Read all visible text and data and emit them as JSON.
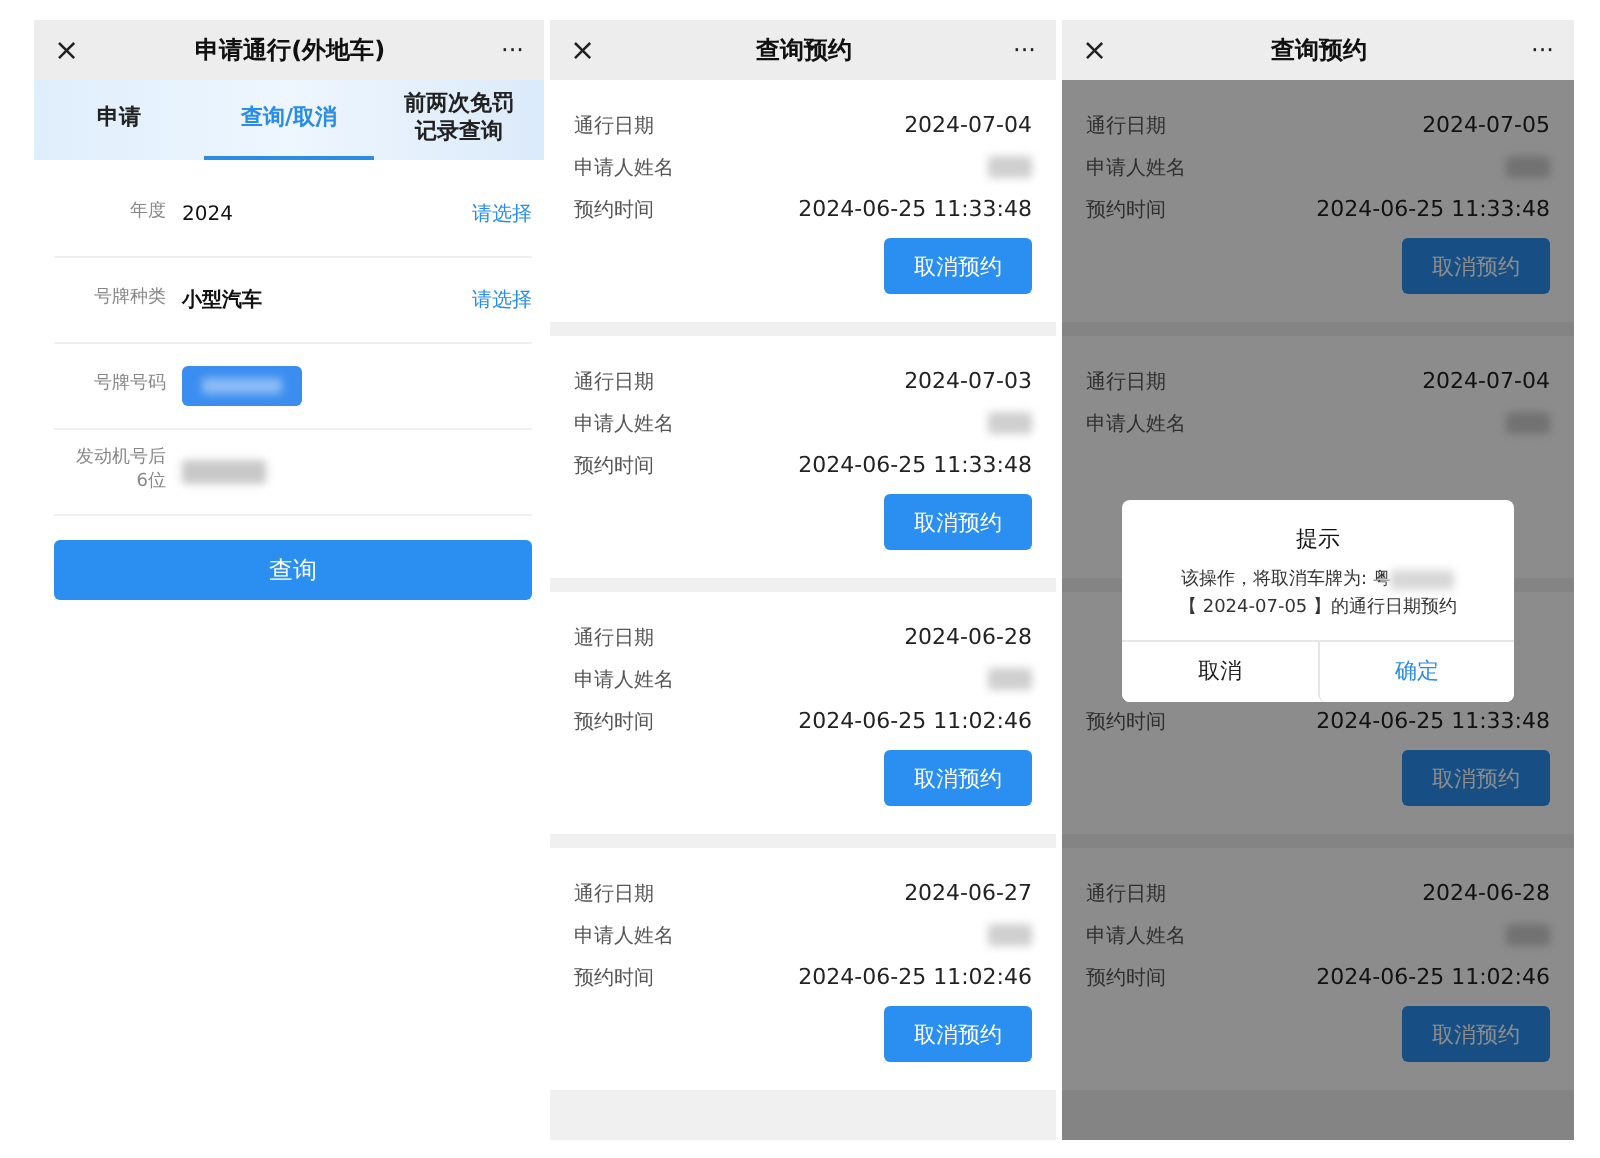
{
  "panels": [
    {
      "kind": "form",
      "header": {
        "close": "×",
        "title": "申请通行(外地车)",
        "more": "···"
      },
      "tabs": [
        {
          "label": "申请",
          "selected": false
        },
        {
          "label": "查询/取消",
          "selected": true
        },
        {
          "label": "前两次免罚记录查询",
          "selected": false
        }
      ],
      "fields": [
        {
          "kind": "select",
          "label": "年度",
          "value": "2024",
          "action": "请选择"
        },
        {
          "kind": "select",
          "label": "号牌种类",
          "value": "小型汽车",
          "action": "请选择"
        },
        {
          "kind": "plate",
          "label": "号牌号码"
        },
        {
          "kind": "redacted",
          "label": "发动机号后\n6位"
        }
      ],
      "submit": "查询"
    },
    {
      "kind": "list",
      "header": {
        "close": "×",
        "title": "查询预约",
        "more": "···"
      },
      "cards": [
        {
          "rows": [
            {
              "kind": "text",
              "label": "通行日期",
              "value": "2024-07-04"
            },
            {
              "kind": "redacted",
              "label": "申请人姓名"
            },
            {
              "kind": "text",
              "label": "预约时间",
              "value": "2024-06-25 11:33:48"
            }
          ],
          "button": "取消预约"
        },
        {
          "rows": [
            {
              "kind": "text",
              "label": "通行日期",
              "value": "2024-07-03"
            },
            {
              "kind": "redacted",
              "label": "申请人姓名"
            },
            {
              "kind": "text",
              "label": "预约时间",
              "value": "2024-06-25 11:33:48"
            }
          ],
          "button": "取消预约"
        },
        {
          "rows": [
            {
              "kind": "text",
              "label": "通行日期",
              "value": "2024-06-28"
            },
            {
              "kind": "redacted",
              "label": "申请人姓名"
            },
            {
              "kind": "text",
              "label": "预约时间",
              "value": "2024-06-25 11:02:46"
            }
          ],
          "button": "取消预约"
        },
        {
          "rows": [
            {
              "kind": "text",
              "label": "通行日期",
              "value": "2024-06-27"
            },
            {
              "kind": "redacted",
              "label": "申请人姓名"
            },
            {
              "kind": "text",
              "label": "预约时间",
              "value": "2024-06-25 11:02:46"
            }
          ],
          "button": "取消预约"
        }
      ]
    },
    {
      "kind": "list",
      "header": {
        "close": "×",
        "title": "查询预约",
        "more": "···"
      },
      "dimmed": true,
      "cards": [
        {
          "rows": [
            {
              "kind": "text",
              "label": "通行日期",
              "value": "2024-07-05"
            },
            {
              "kind": "redacted",
              "label": "申请人姓名"
            },
            {
              "kind": "text",
              "label": "预约时间",
              "value": "2024-06-25 11:33:48"
            }
          ],
          "button": "取消预约"
        },
        {
          "rows": [
            {
              "kind": "text",
              "label": "通行日期",
              "value": "2024-07-04"
            },
            {
              "kind": "redacted",
              "label": "申请人姓名"
            },
            {
              "kind": "hidden"
            }
          ]
        },
        {
          "rows": [
            {
              "kind": "hidden"
            },
            {
              "kind": "hidden"
            },
            {
              "kind": "text",
              "label": "预约时间",
              "value": "2024-06-25 11:33:48"
            }
          ],
          "button": "取消预约"
        },
        {
          "rows": [
            {
              "kind": "text",
              "label": "通行日期",
              "value": "2024-06-28"
            },
            {
              "kind": "redacted",
              "label": "申请人姓名"
            },
            {
              "kind": "text",
              "label": "预约时间",
              "value": "2024-06-25 11:02:46"
            }
          ],
          "button": "取消预约"
        }
      ],
      "dialog": {
        "title": "提示",
        "message_start": "该操作，将取消车牌为: 粤",
        "message_end": "【 2024-07-05 】的通行日期预约",
        "cancel": "取消",
        "confirm": "确定"
      }
    }
  ]
}
